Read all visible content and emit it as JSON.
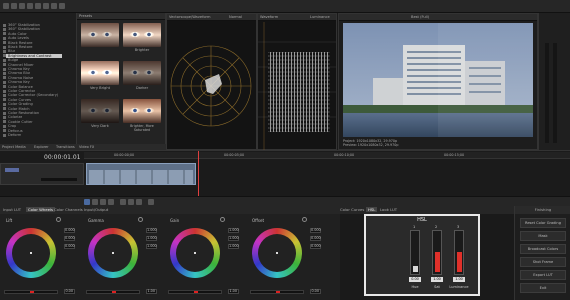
{
  "topbar": {
    "timecode": "00:00:01.01"
  },
  "effects_panel": {
    "label": "Presets",
    "items": [
      "360° Stabilization",
      "360° Stabilization",
      "Auto Color",
      "Auto Levels",
      "Black Restore",
      "Black Restore",
      "Blur",
      "Brightness and Contrast",
      "Bulge",
      "Channel Mixer",
      "Chroma Key",
      "Chroma Blur",
      "Chroma Noise",
      "Chroma Key",
      "Color Balance",
      "Color Corrector",
      "Color Corrector (Secondary)",
      "Color Curves",
      "Color Grading",
      "Color Match",
      "Color Restoration",
      "Colorize",
      "Cookie Cutter",
      "Crop",
      "Defocus",
      "Deform"
    ],
    "selected_index": 7,
    "footer": [
      "Project Media",
      "Explorer",
      "Transitions"
    ]
  },
  "presets": {
    "header": "Presets",
    "items": [
      {
        "label": ""
      },
      {
        "label": "Brighter"
      },
      {
        "label": "Very Bright"
      },
      {
        "label": "Darker"
      },
      {
        "label": "Very Dark"
      },
      {
        "label": "Brighter, More Saturated"
      }
    ],
    "footer": "Video FX"
  },
  "vectorscope": {
    "header": "Vectorscope/Waveform",
    "mode": "Normal"
  },
  "waveform": {
    "header": "Waveform",
    "mode": "Luminance"
  },
  "viewer": {
    "header": "Best (Full)",
    "info": [
      "Project: 1920x1080x32, 29.970p",
      "Preview: 1920x1080x32, 29.970p"
    ],
    "timecode": "00:00:01.01"
  },
  "timeline": {
    "timecode": "00:00:01.01",
    "ruler": [
      "00:00:00;00",
      "00:00:05;00",
      "00:00:10;00",
      "00:00:15;00"
    ]
  },
  "color_tabs": {
    "left": [
      "Input LUT",
      "Color Wheels",
      "Color Channels"
    ],
    "active_left": "Color Wheels",
    "right": [
      "Color Curves",
      "HSL",
      "Look LUT"
    ],
    "active_right": "HSL",
    "section2": "Input/Output"
  },
  "wheels": [
    {
      "name": "Lift",
      "values": [
        "0.000",
        "0.000",
        "0.000"
      ],
      "slider": "0.00"
    },
    {
      "name": "Gamma",
      "values": [
        "1.000",
        "1.000",
        "1.000"
      ],
      "slider": "1.00"
    },
    {
      "name": "Gain",
      "values": [
        "1.000",
        "1.000",
        "1.000"
      ],
      "slider": "1.00"
    },
    {
      "name": "Offset",
      "values": [
        "0.000",
        "0.000",
        "0.000"
      ],
      "slider": "0.00"
    }
  ],
  "hsl": {
    "title": "HSL",
    "channels": [
      {
        "name": "Hue",
        "value": "0.00",
        "top": "1",
        "fraction": 0.15,
        "color": "#d8d8d8"
      },
      {
        "name": "Sat",
        "value": "1.00",
        "top": "2",
        "fraction": 0.5,
        "color": "#e0302a"
      },
      {
        "name": "Luminance",
        "value": "1.00",
        "top": "3",
        "fraction": 0.5,
        "color": "#e0302a"
      }
    ]
  },
  "actions": {
    "header": "Finishing",
    "buttons": [
      "Reset Color Grading",
      "Mask",
      "Broadcast Colors",
      "Shot Frame",
      "Export LUT",
      "Exit"
    ]
  }
}
